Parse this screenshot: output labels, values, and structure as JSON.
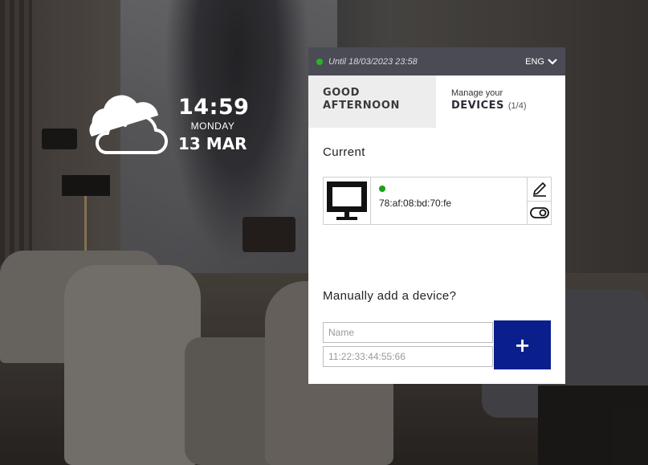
{
  "clock": {
    "time": "14:59",
    "day_of_week": "MONDAY",
    "date": "13 MAR",
    "weather_icon": "cloud-icon"
  },
  "panel": {
    "status": {
      "indicator_color": "#28b428",
      "until_text": "Until 18/03/2023 23:58"
    },
    "language": {
      "selected": "ENG",
      "icon": "chevron-down-icon"
    },
    "tabs": {
      "greeting_line1": "GOOD",
      "greeting_line2": "AFTERNOON",
      "devices_small": "Manage your",
      "devices_big": "DEVICES",
      "devices_count": "(1/4)"
    },
    "current_label": "Current",
    "devices": [
      {
        "icon": "monitor-icon",
        "status_color": "#1aa01a",
        "mac": "78:af:08:bd:70:fe",
        "actions": [
          "edit-icon",
          "toggle-icon"
        ]
      }
    ],
    "manual": {
      "label": "Manually add a device?",
      "name_placeholder": "Name",
      "mac_placeholder": "11:22:33:44:55:66",
      "add_label": "+",
      "add_color": "#0a1e8c"
    }
  }
}
